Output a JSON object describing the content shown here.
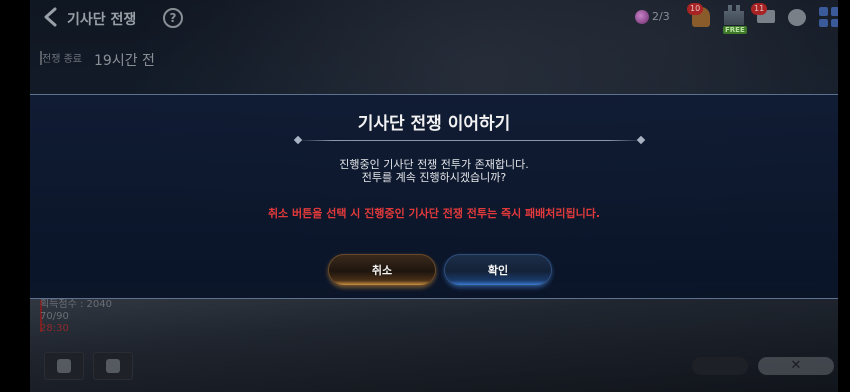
{
  "hud": {
    "title": "기사단 전쟁",
    "help_label": "?",
    "gem_count": "2/3",
    "bell_badge": "10",
    "castle_tag": "FREE",
    "mail_badge": "11"
  },
  "status": {
    "label": "전쟁 종료",
    "time": "19시간 전"
  },
  "bottom_info": {
    "score": "획득점수 : 2040",
    "energy": "70/90",
    "timer": "28:30"
  },
  "modal": {
    "title": "기사단 전쟁 이어하기",
    "body_line1": "진행중인 기사단 전쟁 전투가 존재합니다.",
    "body_line2": "전투를 계속 진행하시겠습니까?",
    "warning": "취소 버튼을 선택 시 진행중인 기사단 전쟁 전투는 즉시 패배처리됩니다.",
    "cancel_label": "취소",
    "confirm_label": "확인"
  },
  "bottom_right": {
    "close_symbol": "✕"
  },
  "colors": {
    "warning": "#e23a3a",
    "modal_bg": "#0e1c34",
    "cancel_glow": "#c89040",
    "confirm_glow": "#3a7ad0"
  }
}
